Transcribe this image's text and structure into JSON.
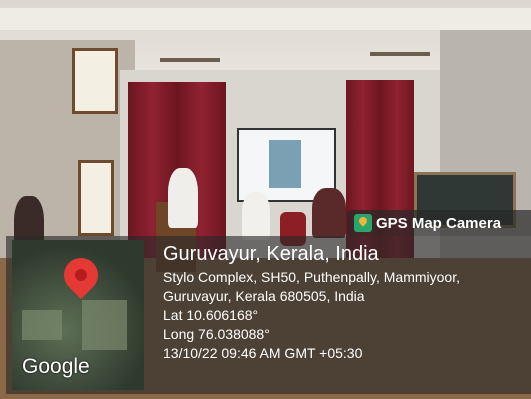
{
  "overlay": {
    "app_name": "GPS Map Camera",
    "location_title": "Guruvayur, Kerala, India",
    "address_line1": "Stylo Complex, SH50, Puthenpally, Mammiyoor,",
    "address_line2": "Guruvayur, Kerala 680505, India",
    "latitude": "Lat 10.606168°",
    "longitude": "Long 76.038088°",
    "datetime": "13/10/22 09:46 AM GMT +05:30",
    "map_logo": "Google",
    "pin_color": "#e53935"
  }
}
